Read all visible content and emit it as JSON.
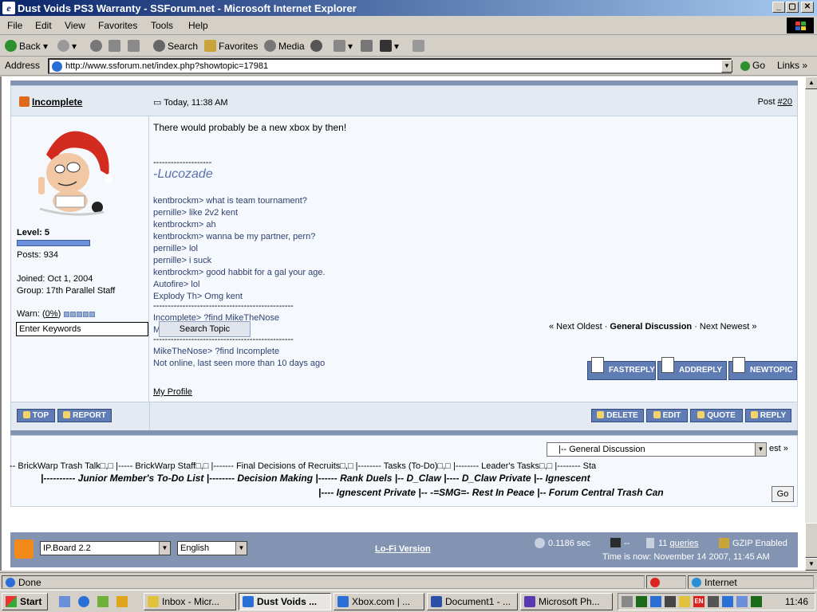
{
  "window": {
    "title": "Dust Voids PS3 Warranty - SSForum.net - Microsoft Internet Explorer",
    "min_glyph": "_",
    "max_glyph": "▢",
    "close_glyph": "✕"
  },
  "menu": [
    "File",
    "Edit",
    "View",
    "Favorites",
    "Tools",
    "Help"
  ],
  "toolbar": {
    "back": "Back",
    "search": "Search",
    "favorites": "Favorites",
    "media": "Media"
  },
  "address": {
    "label": "Address",
    "url": "http://www.ssforum.net/index.php?showtopic=17981",
    "go": "Go",
    "links": "Links",
    "links_more": "»"
  },
  "post": {
    "author": "Incomplete",
    "date": "Today, 11:38 AM",
    "post_label": "Post ",
    "post_number": "#20",
    "message": "There would probably be a new xbox by then!",
    "sig_separator": "--------------------",
    "sig_name": "-Lucozade",
    "chat_lines": [
      "kentbrockm> what is team tournament?",
      "pernille> like 2v2 kent",
      "kentbrockm> ah",
      "kentbrockm> wanna be my partner, pern?",
      "pernille> lol",
      "pernille> i suck",
      "kentbrockm> good habbit for a gal your age.",
      "Autofire> lol",
      "Explody Th> Omg kent"
    ],
    "chat_separator": "------------------------------------------------",
    "chat_lines_2": [
      "Incomplete> ?find MikeTheNose",
      "M                              CC Metal Gear CTF"
    ],
    "chat_lines_3": [
      "MikeTheNose> ?find Incomplete",
      "Not online, last seen more than 10 days ago"
    ],
    "profile_link": "My Profile"
  },
  "user": {
    "level": "Level: 5",
    "posts": "Posts: 934",
    "joined": "Joined: Oct 1, 2004",
    "group": "Group: 17th Parallel Staff",
    "warn_label": "Warn: (",
    "warn_value": "0%",
    "warn_close": ")",
    "level_progress": 1.0
  },
  "search": {
    "placeholder": "Enter Keywords",
    "button": "Search Topic"
  },
  "topicnav": {
    "prev": "« Next Oldest · ",
    "forum": "General Discussion",
    "next": " · Next Newest »"
  },
  "buttons": {
    "fastreply": "FASTREPLY",
    "addreply": "ADDREPLY",
    "newtopic": "NEWTOPIC",
    "top": "TOP",
    "report": "REPORT",
    "delete": "DELETE",
    "edit": "EDIT",
    "quote": "QUOTE",
    "reply": "REPLY"
  },
  "jump": {
    "selected": "|-- General Discussion",
    "trail": "est »",
    "scroll_row": "-- BrickWarp Trash Talk□,□   |----- BrickWarp Staff□,□   |------- Final Decisions of Recruits□,□   |-------- Tasks (To-Do)□,□   |-------- Leader's Tasks□,□   |-------- Sta",
    "row1": "|---------- Junior Member's To-Do List   |-------- Decision Making   |------ Rank Duels   |-- D_Claw   |---- D_Claw Private   |-- Ignescent",
    "row2": "|---- Ignescent Private   |-- -=SMG=- Rest In Peace   |-- Forum Central Trash Can",
    "go": "Go"
  },
  "footer": {
    "skin": "IP.Board 2.2",
    "lang": "English",
    "lofi": "Lo-Fi Version",
    "exec_time": "0.1186 sec",
    "dashes": "--",
    "queries_count": "11 ",
    "queries_link": "queries",
    "gzip": "GZIP Enabled",
    "time": "Time is now: November 14 2007, 11:45 AM"
  },
  "status": {
    "text": "Done",
    "zone": "Internet"
  },
  "taskbar": {
    "start": "Start",
    "tasks": [
      "Inbox - Micr...",
      "Dust Voids ...",
      "Xbox.com | ...",
      "Document1 - ...",
      "Microsoft Ph..."
    ],
    "lang": "EN",
    "clock": "11:46"
  }
}
